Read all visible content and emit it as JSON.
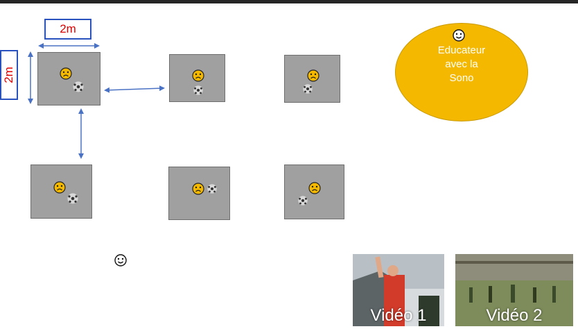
{
  "dimensions": {
    "width_label": "2m",
    "height_label": "2m"
  },
  "educator": {
    "text": "Educateur\navec la\nSono",
    "fill": "#f5b800"
  },
  "videos": [
    {
      "label": "Vidéo 1"
    },
    {
      "label": "Vidéo 2"
    }
  ],
  "colors": {
    "square": "#a0a0a0",
    "arrow": "#4a72c4",
    "dimension_text": "#e00000",
    "sad_face": "#f5b800"
  },
  "icons": {
    "sad_face": "sad-face-icon",
    "smiley": "smiley-icon",
    "ball": "soccer-ball-icon"
  }
}
